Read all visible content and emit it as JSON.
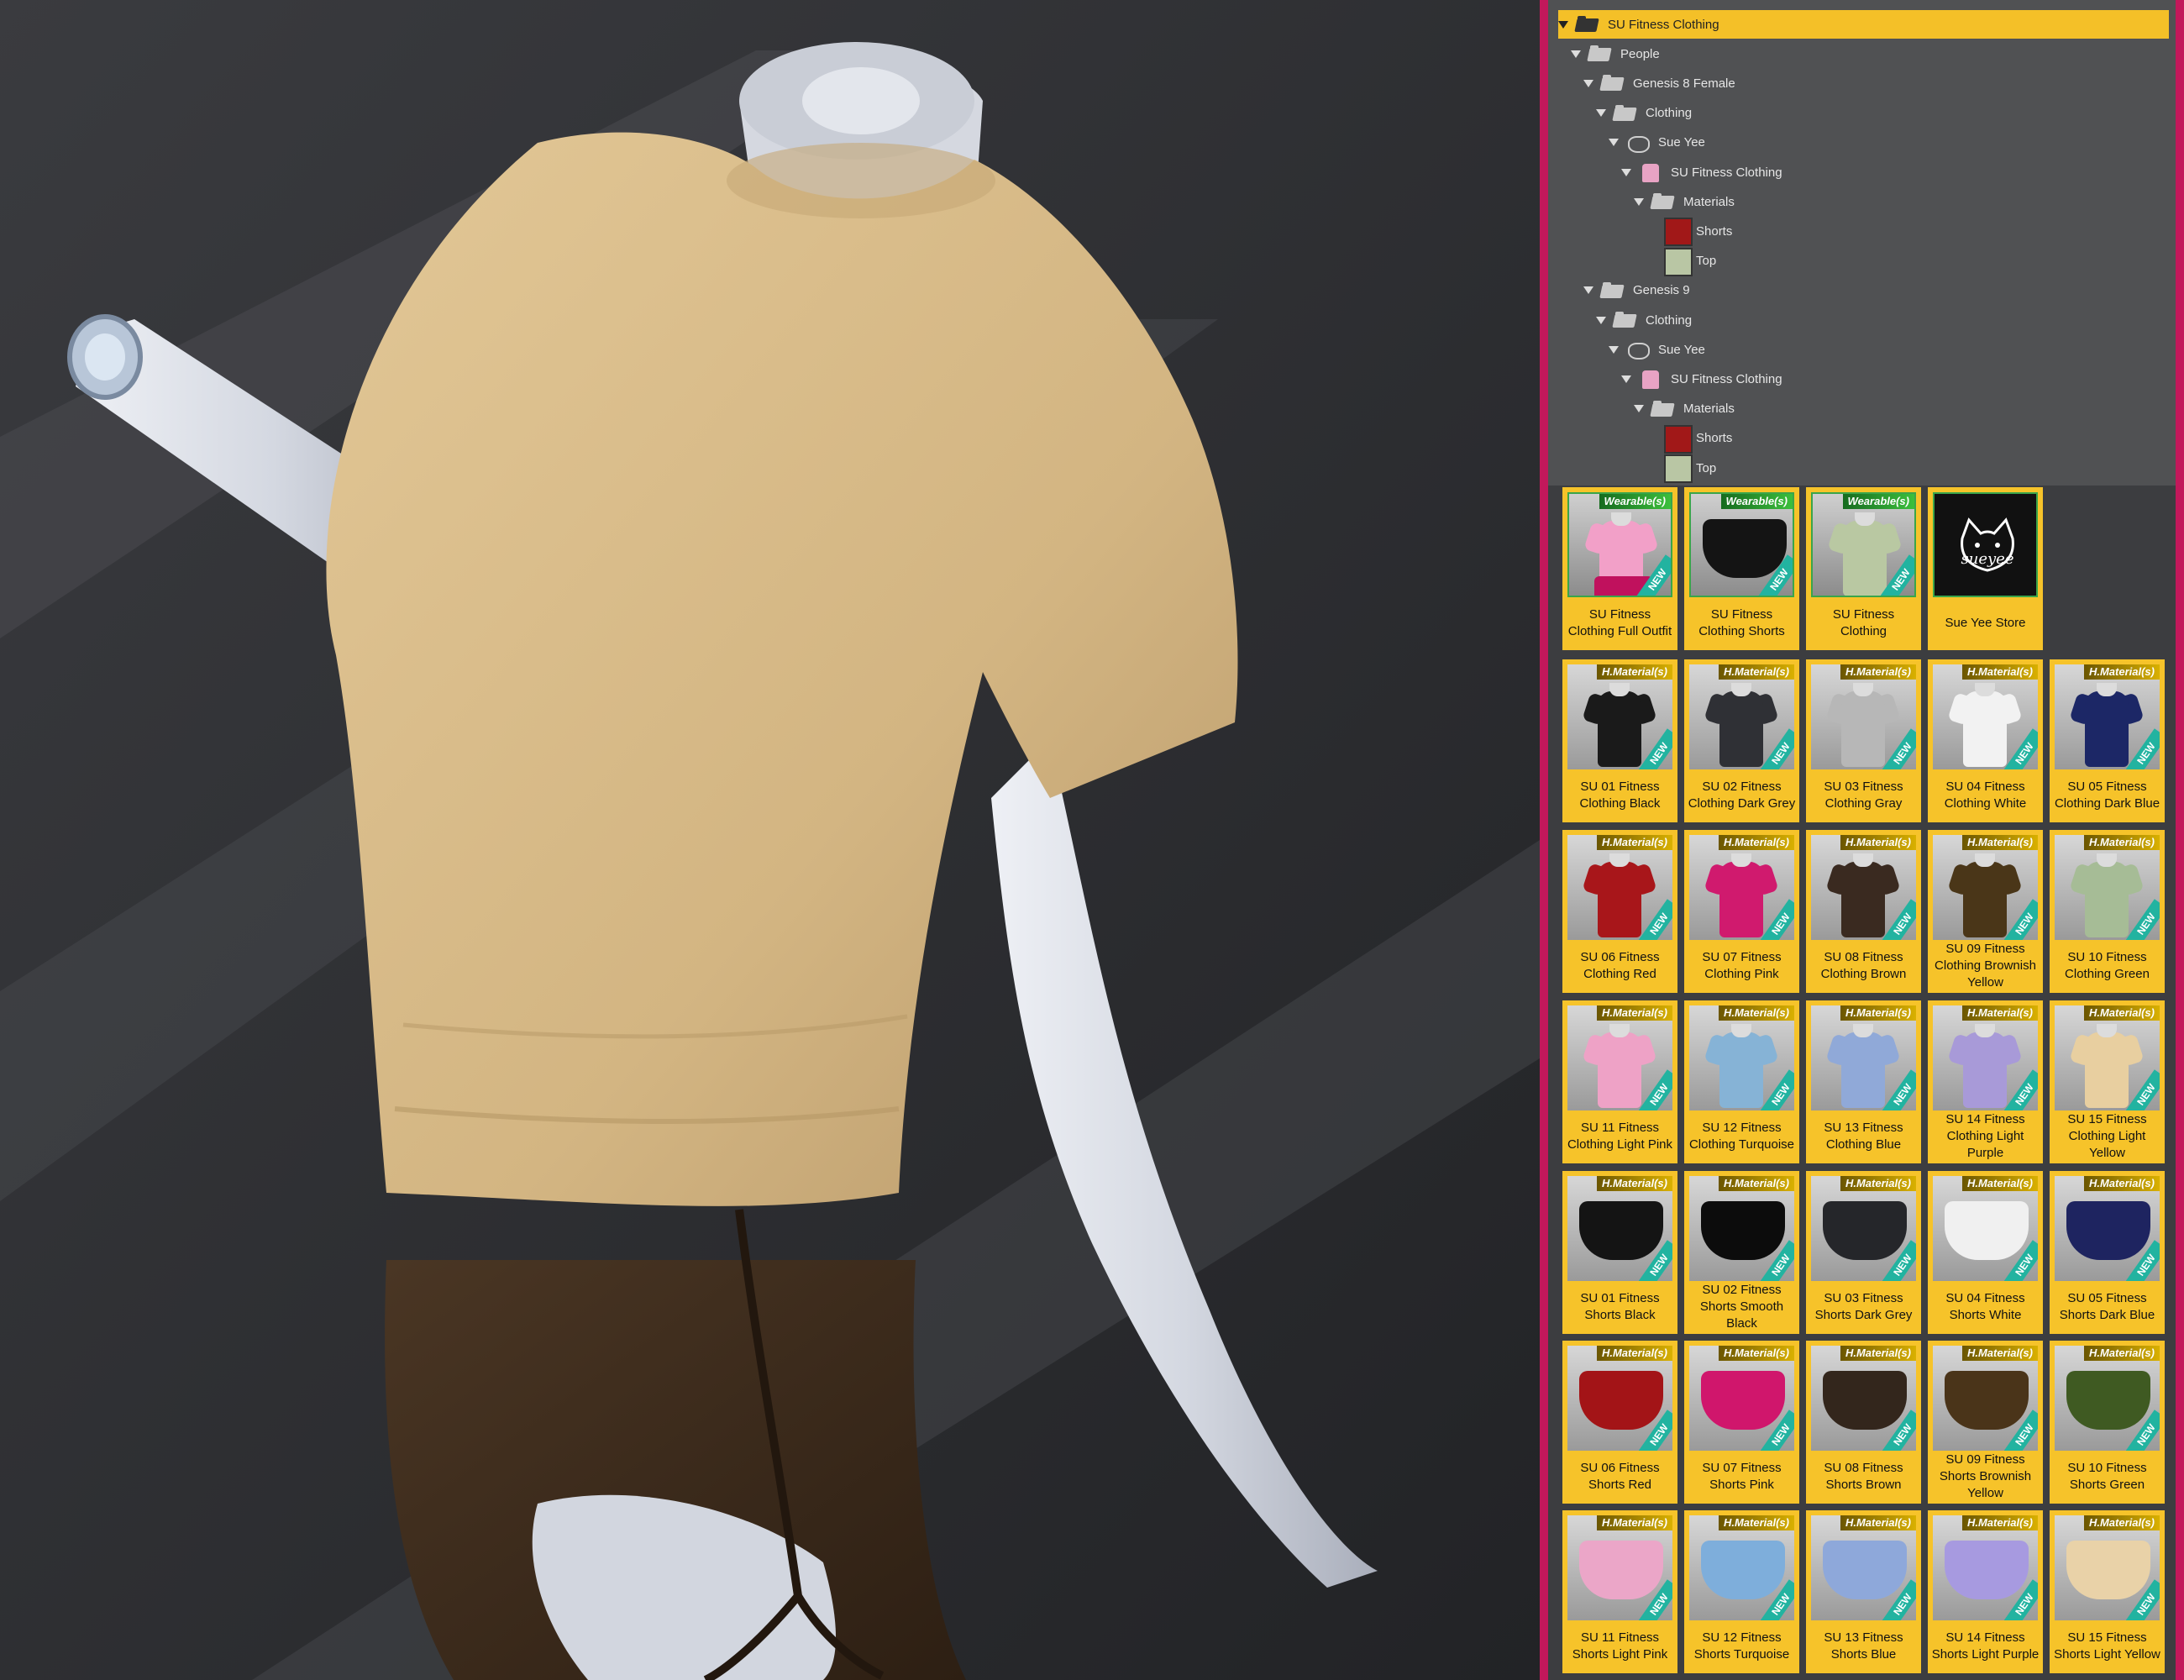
{
  "tree": [
    {
      "label": "SU Fitness Clothing",
      "icon": "folder-icon",
      "depth": 0,
      "selected": true
    },
    {
      "label": "People",
      "icon": "folder-icon",
      "depth": 1
    },
    {
      "label": "Genesis 8 Female",
      "icon": "folder-icon",
      "depth": 2
    },
    {
      "label": "Clothing",
      "icon": "folder-icon",
      "depth": 3
    },
    {
      "label": "Sue Yee",
      "icon": "cat-icon",
      "depth": 4
    },
    {
      "label": "SU Fitness Clothing",
      "icon": "shirt-icon",
      "depth": 5
    },
    {
      "label": "Materials",
      "icon": "folder-icon",
      "depth": 6
    },
    {
      "label": "Shorts",
      "icon": "red-thumb",
      "depth": 7,
      "leaf": true
    },
    {
      "label": "Top",
      "icon": "top-thumb",
      "depth": 7,
      "leaf": true
    },
    {
      "label": "Genesis 9",
      "icon": "folder-icon",
      "depth": 2
    },
    {
      "label": "Clothing",
      "icon": "folder-icon",
      "depth": 3
    },
    {
      "label": "Sue Yee",
      "icon": "cat-icon",
      "depth": 4
    },
    {
      "label": "SU Fitness Clothing",
      "icon": "shirt-icon",
      "depth": 5
    },
    {
      "label": "Materials",
      "icon": "folder-icon",
      "depth": 6
    },
    {
      "label": "Shorts",
      "icon": "red-thumb",
      "depth": 7,
      "leaf": true
    },
    {
      "label": "Top",
      "icon": "top-thumb",
      "depth": 7,
      "leaf": true
    }
  ],
  "badges": {
    "wearable": "Wearable(s)",
    "material": "H.Material(s)",
    "new": "NEW"
  },
  "wearables": [
    {
      "label": "SU Fitness Clothing Full Outfit",
      "kind": "outfit",
      "color": "#f2a0c8"
    },
    {
      "label": "SU Fitness Clothing Shorts",
      "kind": "short",
      "color": "#141414"
    },
    {
      "label": "SU Fitness Clothing",
      "kind": "shirt",
      "color": "#b9c8a2"
    },
    {
      "label": "Sue Yee Store",
      "kind": "logo",
      "color": "#111111",
      "logo_text": "sueyee"
    }
  ],
  "tops": [
    {
      "label": "SU 01 Fitness Clothing Black",
      "color": "#1a1a1a"
    },
    {
      "label": "SU 02 Fitness Clothing Dark Grey",
      "color": "#2f3035"
    },
    {
      "label": "SU 03 Fitness Clothing Gray",
      "color": "#b7b7b7"
    },
    {
      "label": "SU 04 Fitness Clothing White",
      "color": "#f2f2f2"
    },
    {
      "label": "SU 05 Fitness Clothing Dark Blue",
      "color": "#1c2766"
    },
    {
      "label": "SU 06 Fitness Clothing Red",
      "color": "#a8161a"
    },
    {
      "label": "SU 07 Fitness Clothing Pink",
      "color": "#d01a6e"
    },
    {
      "label": "SU 08 Fitness Clothing Brown",
      "color": "#3a2a20"
    },
    {
      "label": "SU 09 Fitness Clothing Brownish Yellow",
      "color": "#4a3618"
    },
    {
      "label": "SU 10 Fitness Clothing Green",
      "color": "#a6bc96"
    },
    {
      "label": "SU 11 Fitness Clothing Light Pink",
      "color": "#eea2c6"
    },
    {
      "label": "SU 12 Fitness Clothing Turquoise",
      "color": "#86b3d6"
    },
    {
      "label": "SU 13 Fitness Clothing Blue",
      "color": "#90a9d8"
    },
    {
      "label": "SU 14 Fitness Clothing Light Purple",
      "color": "#a89ad8"
    },
    {
      "label": "SU 15 Fitness Clothing Light Yellow",
      "color": "#e8cfa0"
    }
  ],
  "shorts": [
    {
      "label": "SU 01 Fitness Shorts Black",
      "color": "#141414"
    },
    {
      "label": "SU 02 Fitness Shorts Smooth Black",
      "color": "#0c0c0c"
    },
    {
      "label": "SU 03 Fitness Shorts Dark Grey",
      "color": "#25262a"
    },
    {
      "label": "SU 04 Fitness Shorts White",
      "color": "#f0f0f0"
    },
    {
      "label": "SU 05 Fitness Shorts Dark Blue",
      "color": "#1e2460"
    },
    {
      "label": "SU 06 Fitness Shorts Red",
      "color": "#a31417"
    },
    {
      "label": "SU 07 Fitness Shorts Pink",
      "color": "#d0166c"
    },
    {
      "label": "SU 08 Fitness Shorts Brown",
      "color": "#33261c"
    },
    {
      "label": "SU 09 Fitness Shorts Brownish Yellow",
      "color": "#4a3419"
    },
    {
      "label": "SU 10 Fitness Shorts Green",
      "color": "#3f5a22"
    },
    {
      "label": "SU 11 Fitness Shorts Light Pink",
      "color": "#eba6c8"
    },
    {
      "label": "SU 12 Fitness Shorts Turquoise",
      "color": "#7eaedb"
    },
    {
      "label": "SU 13 Fitness Shorts Blue",
      "color": "#8ea8da"
    },
    {
      "label": "SU 14 Fitness Shorts Light Purple",
      "color": "#a79ae0"
    },
    {
      "label": "SU 15 Fitness Shorts Light Yellow",
      "color": "#e9d2a8"
    }
  ],
  "colors": {
    "accent": "#f6c32a",
    "frame": "#c2185b",
    "panel_bg": "#3c3d40",
    "tree_bg": "#505153",
    "shirt": "#d9bd8c",
    "shorts": "#3b2a1a",
    "mannequin": "#d8dbe3"
  }
}
